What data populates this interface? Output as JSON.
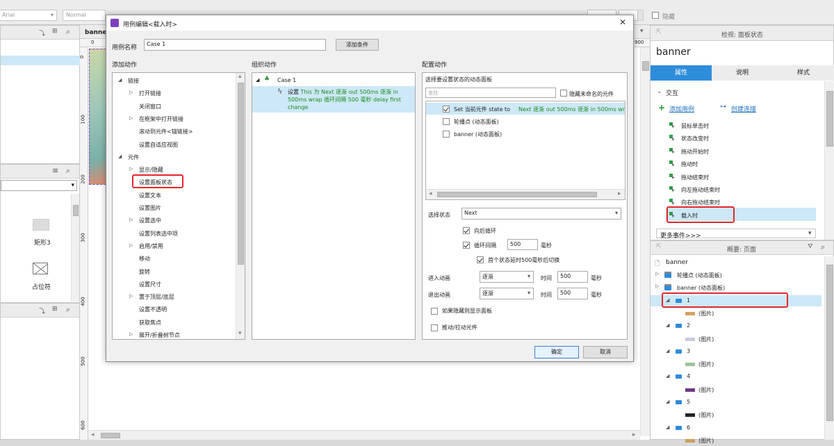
{
  "toolbar": {
    "font_select": "Arial",
    "style_select": "Normal",
    "hidden_label": "隐藏"
  },
  "canvas": {
    "tab_title": "banner",
    "ruler_top": [
      "0",
      "900"
    ],
    "ruler_left": [
      "0",
      "100",
      "200",
      "300",
      "400",
      "500",
      "600"
    ]
  },
  "library": {
    "items": [
      {
        "label": "矩形3",
        "icon": "rectangle-icon"
      },
      {
        "label": "占位符",
        "icon": "placeholder-icon"
      }
    ]
  },
  "dialog": {
    "title": "用例编辑<载入时>",
    "case_name_label": "用例名称",
    "case_name_value": "Case 1",
    "add_condition": "添加条件",
    "col1_title": "添加动作",
    "col2_title": "组织动作",
    "col3_title": "配置动作",
    "actions": [
      {
        "label": "链接",
        "level": 0,
        "toggle": "open"
      },
      {
        "label": "打开链接",
        "level": 1,
        "toggle": "closed"
      },
      {
        "label": "关闭窗口",
        "level": 1,
        "toggle": ""
      },
      {
        "label": "在框架中打开链接",
        "level": 1,
        "toggle": "closed"
      },
      {
        "label": "滚动到元件<锚链接>",
        "level": 1,
        "toggle": ""
      },
      {
        "label": "设置自适应视图",
        "level": 1,
        "toggle": ""
      },
      {
        "label": "元件",
        "level": 0,
        "toggle": "open"
      },
      {
        "label": "显示/隐藏",
        "level": 1,
        "toggle": "closed"
      },
      {
        "label": "设置面板状态",
        "level": 1,
        "toggle": "",
        "highlight": true
      },
      {
        "label": "设置文本",
        "level": 1,
        "toggle": ""
      },
      {
        "label": "设置图片",
        "level": 1,
        "toggle": ""
      },
      {
        "label": "设置选中",
        "level": 1,
        "toggle": "closed"
      },
      {
        "label": "设置列表选中项",
        "level": 1,
        "toggle": ""
      },
      {
        "label": "启用/禁用",
        "level": 1,
        "toggle": "closed"
      },
      {
        "label": "移动",
        "level": 1,
        "toggle": ""
      },
      {
        "label": "旋转",
        "level": 1,
        "toggle": ""
      },
      {
        "label": "设置尺寸",
        "level": 1,
        "toggle": ""
      },
      {
        "label": "置于顶层/底层",
        "level": 1,
        "toggle": "closed"
      },
      {
        "label": "设置不透明",
        "level": 1,
        "toggle": ""
      },
      {
        "label": "获取焦点",
        "level": 1,
        "toggle": ""
      },
      {
        "label": "展开/折叠树节点",
        "level": 1,
        "toggle": "closed"
      }
    ],
    "organize": {
      "case_label": "Case 1",
      "action_prefix": "设置",
      "action_text": "This 为 Next 逐渐 out 500ms 逐渐 in 500ms wrap 循环间隔 500 毫秒 delay first change"
    },
    "config": {
      "select_panel_label": "选择要设置状态的动态面板",
      "search_placeholder": "查找",
      "hide_unnamed": "隐藏未命名的元件",
      "panels": [
        {
          "prefix": "Set 当前元件 state to ",
          "value": "Next 逐渐 out 500ms 逐渐 in 500ms wra",
          "checked": true
        },
        {
          "prefix": "轮播点 (动态面板)",
          "value": "",
          "checked": false
        },
        {
          "prefix": "banner (动态面板)",
          "value": "",
          "checked": false
        }
      ],
      "select_state_label": "选择状态",
      "select_state_value": "Next",
      "wrap_label": "向后循环",
      "interval_label": "循环间隔",
      "interval_value": "500",
      "interval_unit": "毫秒",
      "delay_label": "首个状态延时500毫秒后切换",
      "enter_anim_label": "进入动画",
      "enter_anim_value": "逐渐",
      "time_label": "时间",
      "enter_time": "500",
      "ms": "毫秒",
      "exit_anim_label": "退出动画",
      "exit_anim_value": "逐渐",
      "exit_time": "500",
      "show_if_hidden": "如果隐藏则显示面板",
      "push_pull": "推动/拉动元件"
    },
    "ok": "确定",
    "cancel": "取消"
  },
  "inspector": {
    "header": "检视: 面板状态",
    "name": "banner",
    "tabs": [
      "属性",
      "说明",
      "样式"
    ],
    "section": "交互",
    "add_case": "添加用例",
    "create_link": "创建连接",
    "events": [
      "鼠标单击时",
      "状态改变时",
      "拖动开始时",
      "拖动时",
      "拖动结束时",
      "向左拖动结束时",
      "向右拖动结束时",
      "载入时"
    ],
    "more_events": "更多事件>>>"
  },
  "outline": {
    "header": "概要: 页面",
    "root": "banner",
    "nodes": [
      {
        "label": "轮播点 (动态面板)",
        "level": 0,
        "type": "panel"
      },
      {
        "label": "banner (动态面板)",
        "level": 0,
        "type": "panel"
      },
      {
        "label": "1",
        "level": 1,
        "type": "state",
        "highlight": true
      },
      {
        "label": "(图片)",
        "level": 2,
        "type": "image",
        "color": "#d9a060"
      },
      {
        "label": "2",
        "level": 1,
        "type": "state"
      },
      {
        "label": "(图片)",
        "level": 2,
        "type": "image",
        "color": "#c9c9e0"
      },
      {
        "label": "3",
        "level": 1,
        "type": "state"
      },
      {
        "label": "(图片)",
        "level": 2,
        "type": "image",
        "color": "#9cc49c"
      },
      {
        "label": "4",
        "level": 1,
        "type": "state"
      },
      {
        "label": "(图片)",
        "level": 2,
        "type": "image",
        "color": "#6a3a8a"
      },
      {
        "label": "5",
        "level": 1,
        "type": "state"
      },
      {
        "label": "(图片)",
        "level": 2,
        "type": "image",
        "color": "#222222"
      },
      {
        "label": "6",
        "level": 1,
        "type": "state"
      },
      {
        "label": "(图片)",
        "level": 2,
        "type": "image",
        "color": "#c9a060"
      }
    ]
  },
  "colors": {
    "accent": "#2e8ddb",
    "highlight_row": "#cde8f7",
    "red_box": "#e5262b"
  }
}
